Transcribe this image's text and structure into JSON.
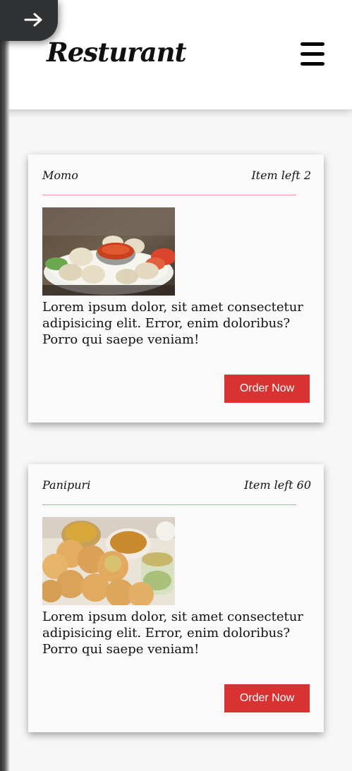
{
  "header": {
    "logo": "Resturant",
    "menu_icon": "hamburger-menu-icon",
    "toggle_icon": "arrow-right-icon"
  },
  "items": [
    {
      "name": "Momo",
      "items_left": "Item left 2",
      "image": "momo-dumplings-photo",
      "description": "Lorem ipsum dolor, sit amet consectetur adipisicing elit. Error, enim doloribus? Porro qui saepe veniam!",
      "order_label": "Order Now"
    },
    {
      "name": "Panipuri",
      "items_left": "Item left 60",
      "image": "panipuri-photo",
      "description": "Lorem ipsum dolor, sit amet consectetur adipisicing elit. Error, enim doloribus? Porro qui saepe veniam!",
      "order_label": "Order Now"
    }
  ],
  "colors": {
    "accent": "#d83232",
    "divider": "#f0a090",
    "toggle_bg": "#303233",
    "card_bg": "#fafafa"
  }
}
